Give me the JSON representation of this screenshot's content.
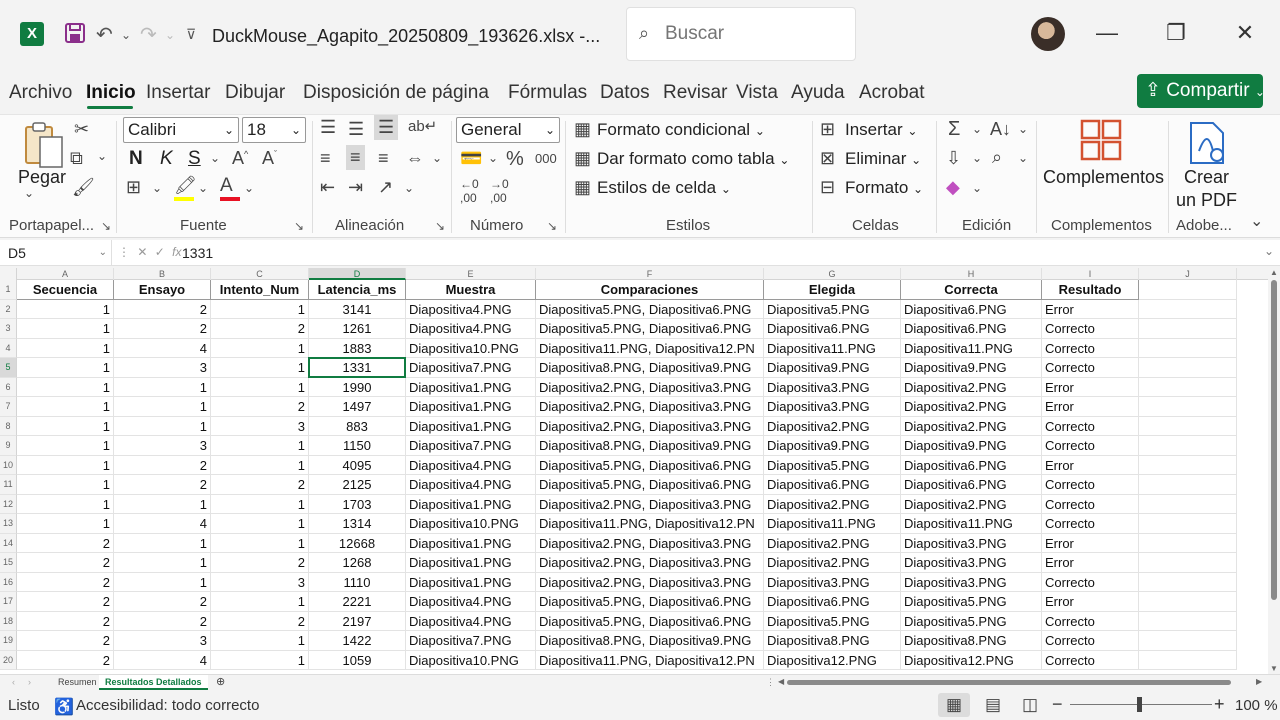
{
  "window": {
    "title": "DuckMouse_Agapito_20250809_193626.xlsx  -...",
    "search_placeholder": "Buscar"
  },
  "menu": [
    "Archivo",
    "Inicio",
    "Insertar",
    "Dibujar",
    "Disposición de página",
    "Fórmulas",
    "Datos",
    "Revisar",
    "Vista",
    "Ayuda",
    "Acrobat"
  ],
  "share_label": "Compartir",
  "ribbon": {
    "paste": "Pegar",
    "font_name": "Calibri",
    "font_size": "18",
    "bold": "N",
    "italic": "K",
    "underline": "S",
    "number_format": "General",
    "conditional_format": "Formato condicional",
    "format_as_table": "Dar formato como tabla",
    "cell_styles": "Estilos de celda",
    "insert": "Insertar",
    "delete": "Eliminar",
    "format": "Formato",
    "addins": "Complementos",
    "create_pdf_1": "Crear",
    "create_pdf_2": "un PDF",
    "groups": {
      "clipboard": "Portapapel...",
      "font": "Fuente",
      "alignment": "Alineación",
      "number": "Número",
      "styles": "Estilos",
      "cells": "Celdas",
      "editing": "Edición",
      "addins": "Complementos",
      "adobe": "Adobe..."
    }
  },
  "formula_bar": {
    "name_box": "D5",
    "fx": "fx",
    "value": "1331"
  },
  "columns": [
    "A",
    "B",
    "C",
    "D",
    "E",
    "F",
    "G",
    "H",
    "I",
    "J"
  ],
  "headers": [
    "Secuencia",
    "Ensayo",
    "Intento_Num",
    "Latencia_ms",
    "Muestra",
    "Comparaciones",
    "Elegida",
    "Correcta",
    "Resultado"
  ],
  "rows": [
    [
      "1",
      "2",
      "1",
      "3141",
      "Diapositiva4.PNG",
      "Diapositiva5.PNG, Diapositiva6.PNG",
      "Diapositiva5.PNG",
      "Diapositiva6.PNG",
      "Error"
    ],
    [
      "1",
      "2",
      "2",
      "1261",
      "Diapositiva4.PNG",
      "Diapositiva5.PNG, Diapositiva6.PNG",
      "Diapositiva6.PNG",
      "Diapositiva6.PNG",
      "Correcto"
    ],
    [
      "1",
      "4",
      "1",
      "1883",
      "Diapositiva10.PNG",
      "Diapositiva11.PNG, Diapositiva12.PN",
      "Diapositiva11.PNG",
      "Diapositiva11.PNG",
      "Correcto"
    ],
    [
      "1",
      "3",
      "1",
      "1331",
      "Diapositiva7.PNG",
      "Diapositiva8.PNG, Diapositiva9.PNG",
      "Diapositiva9.PNG",
      "Diapositiva9.PNG",
      "Correcto"
    ],
    [
      "1",
      "1",
      "1",
      "1990",
      "Diapositiva1.PNG",
      "Diapositiva2.PNG, Diapositiva3.PNG",
      "Diapositiva3.PNG",
      "Diapositiva2.PNG",
      "Error"
    ],
    [
      "1",
      "1",
      "2",
      "1497",
      "Diapositiva1.PNG",
      "Diapositiva2.PNG, Diapositiva3.PNG",
      "Diapositiva3.PNG",
      "Diapositiva2.PNG",
      "Error"
    ],
    [
      "1",
      "1",
      "3",
      "883",
      "Diapositiva1.PNG",
      "Diapositiva2.PNG, Diapositiva3.PNG",
      "Diapositiva2.PNG",
      "Diapositiva2.PNG",
      "Correcto"
    ],
    [
      "1",
      "3",
      "1",
      "1150",
      "Diapositiva7.PNG",
      "Diapositiva8.PNG, Diapositiva9.PNG",
      "Diapositiva9.PNG",
      "Diapositiva9.PNG",
      "Correcto"
    ],
    [
      "1",
      "2",
      "1",
      "4095",
      "Diapositiva4.PNG",
      "Diapositiva5.PNG, Diapositiva6.PNG",
      "Diapositiva5.PNG",
      "Diapositiva6.PNG",
      "Error"
    ],
    [
      "1",
      "2",
      "2",
      "2125",
      "Diapositiva4.PNG",
      "Diapositiva5.PNG, Diapositiva6.PNG",
      "Diapositiva6.PNG",
      "Diapositiva6.PNG",
      "Correcto"
    ],
    [
      "1",
      "1",
      "1",
      "1703",
      "Diapositiva1.PNG",
      "Diapositiva2.PNG, Diapositiva3.PNG",
      "Diapositiva2.PNG",
      "Diapositiva2.PNG",
      "Correcto"
    ],
    [
      "1",
      "4",
      "1",
      "1314",
      "Diapositiva10.PNG",
      "Diapositiva11.PNG, Diapositiva12.PN",
      "Diapositiva11.PNG",
      "Diapositiva11.PNG",
      "Correcto"
    ],
    [
      "2",
      "1",
      "1",
      "12668",
      "Diapositiva1.PNG",
      "Diapositiva2.PNG, Diapositiva3.PNG",
      "Diapositiva2.PNG",
      "Diapositiva3.PNG",
      "Error"
    ],
    [
      "2",
      "1",
      "2",
      "1268",
      "Diapositiva1.PNG",
      "Diapositiva2.PNG, Diapositiva3.PNG",
      "Diapositiva2.PNG",
      "Diapositiva3.PNG",
      "Error"
    ],
    [
      "2",
      "1",
      "3",
      "1110",
      "Diapositiva1.PNG",
      "Diapositiva2.PNG, Diapositiva3.PNG",
      "Diapositiva3.PNG",
      "Diapositiva3.PNG",
      "Correcto"
    ],
    [
      "2",
      "2",
      "1",
      "2221",
      "Diapositiva4.PNG",
      "Diapositiva5.PNG, Diapositiva6.PNG",
      "Diapositiva6.PNG",
      "Diapositiva5.PNG",
      "Error"
    ],
    [
      "2",
      "2",
      "2",
      "2197",
      "Diapositiva4.PNG",
      "Diapositiva5.PNG, Diapositiva6.PNG",
      "Diapositiva5.PNG",
      "Diapositiva5.PNG",
      "Correcto"
    ],
    [
      "2",
      "3",
      "1",
      "1422",
      "Diapositiva7.PNG",
      "Diapositiva8.PNG, Diapositiva9.PNG",
      "Diapositiva8.PNG",
      "Diapositiva8.PNG",
      "Correcto"
    ],
    [
      "2",
      "4",
      "1",
      "1059",
      "Diapositiva10.PNG",
      "Diapositiva11.PNG, Diapositiva12.PN",
      "Diapositiva12.PNG",
      "Diapositiva12.PNG",
      "Correcto"
    ]
  ],
  "sheets": [
    "Resumen",
    "Resultados Detallados"
  ],
  "active_sheet": "Resultados Detallados",
  "status": {
    "ready": "Listo",
    "accessibility": "Accesibilidad: todo correcto",
    "zoom": "100 %"
  },
  "colors": {
    "accent": "#107c41",
    "font_color": "#e81123",
    "highlight": "#ffff00"
  }
}
